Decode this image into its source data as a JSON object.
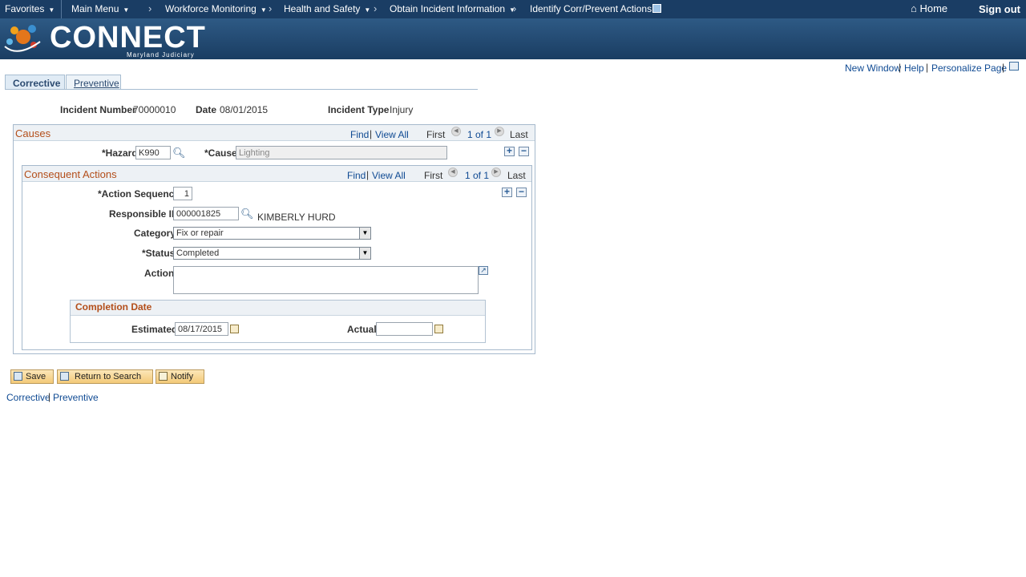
{
  "nav": {
    "favorites": "Favorites",
    "main_menu": "Main Menu",
    "crumbs": [
      "Workforce Monitoring",
      "Health and Safety",
      "Obtain Incident Information",
      "Identify Corr/Prevent Actions"
    ],
    "home": "Home",
    "sign_out": "Sign out"
  },
  "banner": {
    "logo": "CONNECT",
    "logo_sub": "Maryland Judiciary"
  },
  "toplinks": {
    "new_window": "New Window",
    "help": "Help",
    "personalize": "Personalize Page"
  },
  "tabs": {
    "corrective": "Corrective",
    "preventive": "Preventive"
  },
  "header": {
    "incident_number_label": "Incident Number",
    "incident_number": "70000010",
    "date_label": "Date",
    "date": "08/01/2015",
    "incident_type_label": "Incident Type",
    "incident_type": "Injury"
  },
  "causes": {
    "title": "Causes",
    "find": "Find",
    "view_all": "View All",
    "first": "First",
    "count": "1 of 1",
    "last": "Last",
    "hazard_label": "*Hazard",
    "hazard": "K990",
    "cause_label": "*Cause",
    "cause": "Lighting"
  },
  "actions": {
    "title": "Consequent Actions",
    "find": "Find",
    "view_all": "View All",
    "first": "First",
    "count": "1 of 1",
    "last": "Last",
    "seq_label": "*Action Sequence",
    "seq": "1",
    "resp_label": "Responsible ID",
    "resp": "000001825",
    "resp_name": "KIMBERLY HURD",
    "category_label": "Category",
    "category": "Fix or repair",
    "status_label": "*Status",
    "status": "Completed",
    "action_label": "Action",
    "action": ""
  },
  "completion": {
    "title": "Completion Date",
    "estimated_label": "Estimated",
    "estimated": "08/17/2015",
    "actual_label": "Actual",
    "actual": ""
  },
  "buttons": {
    "save": "Save",
    "return": "Return to Search",
    "notify": "Notify"
  },
  "footer": {
    "corrective": "Corrective",
    "preventive": "Preventive"
  }
}
